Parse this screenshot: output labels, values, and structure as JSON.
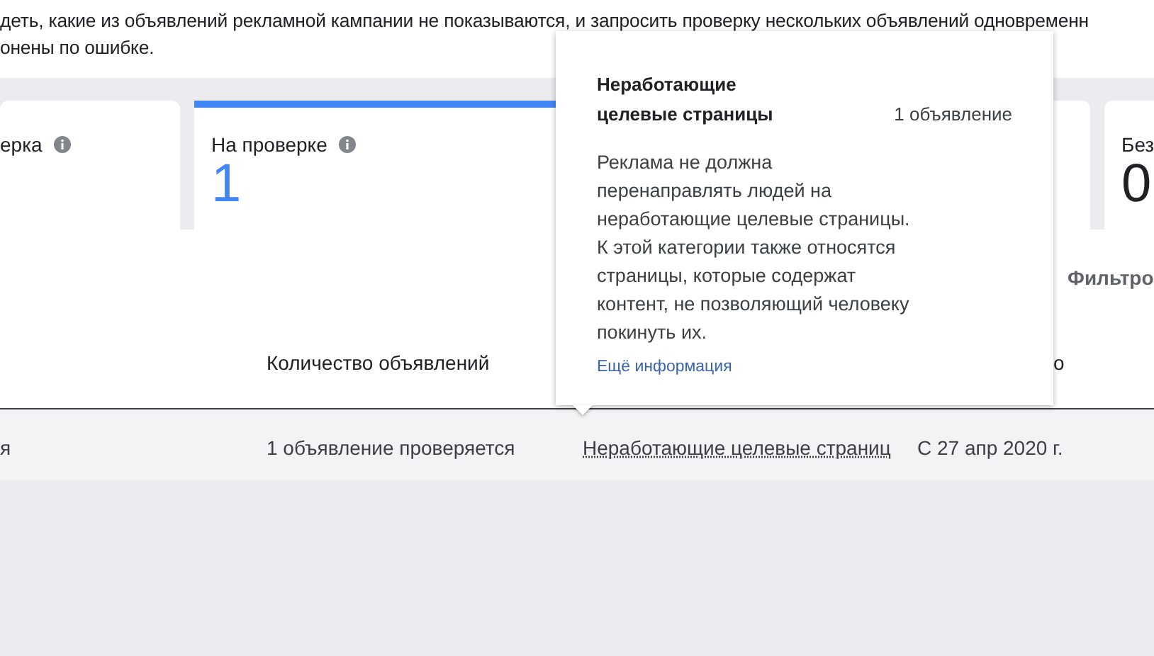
{
  "intro": [
    "деть, какие из объявлений рекламной кампании не показываются, и запросить проверку нескольких объявлений одновременн",
    "онены по ошибке."
  ],
  "cards": [
    {
      "label": "ерка",
      "info": true,
      "selected": false
    },
    {
      "label": "На проверке",
      "info": true,
      "value": "1",
      "selected": true
    },
    {
      "selected": false
    },
    {
      "label": "Без",
      "value": "0",
      "selected": false
    }
  ],
  "filter_label": "Фильтро",
  "table": {
    "columns": [
      "",
      "Количество объявлений",
      "",
      "о"
    ],
    "rows": [
      {
        "cells": [
          "я",
          "1 объявление проверяется",
          "Неработающие целевые страниц",
          "С 27 апр 2020 г."
        ]
      }
    ]
  },
  "tooltip": {
    "title": "Неработающие целевые страницы",
    "count": "1 объявление",
    "body": "Реклама не должна перенаправлять людей на неработающие целевые страницы. К этой категории также относятся страницы, которые содержат контент, не позволяющий человеку покинуть их.",
    "link": "Ещё информация"
  }
}
